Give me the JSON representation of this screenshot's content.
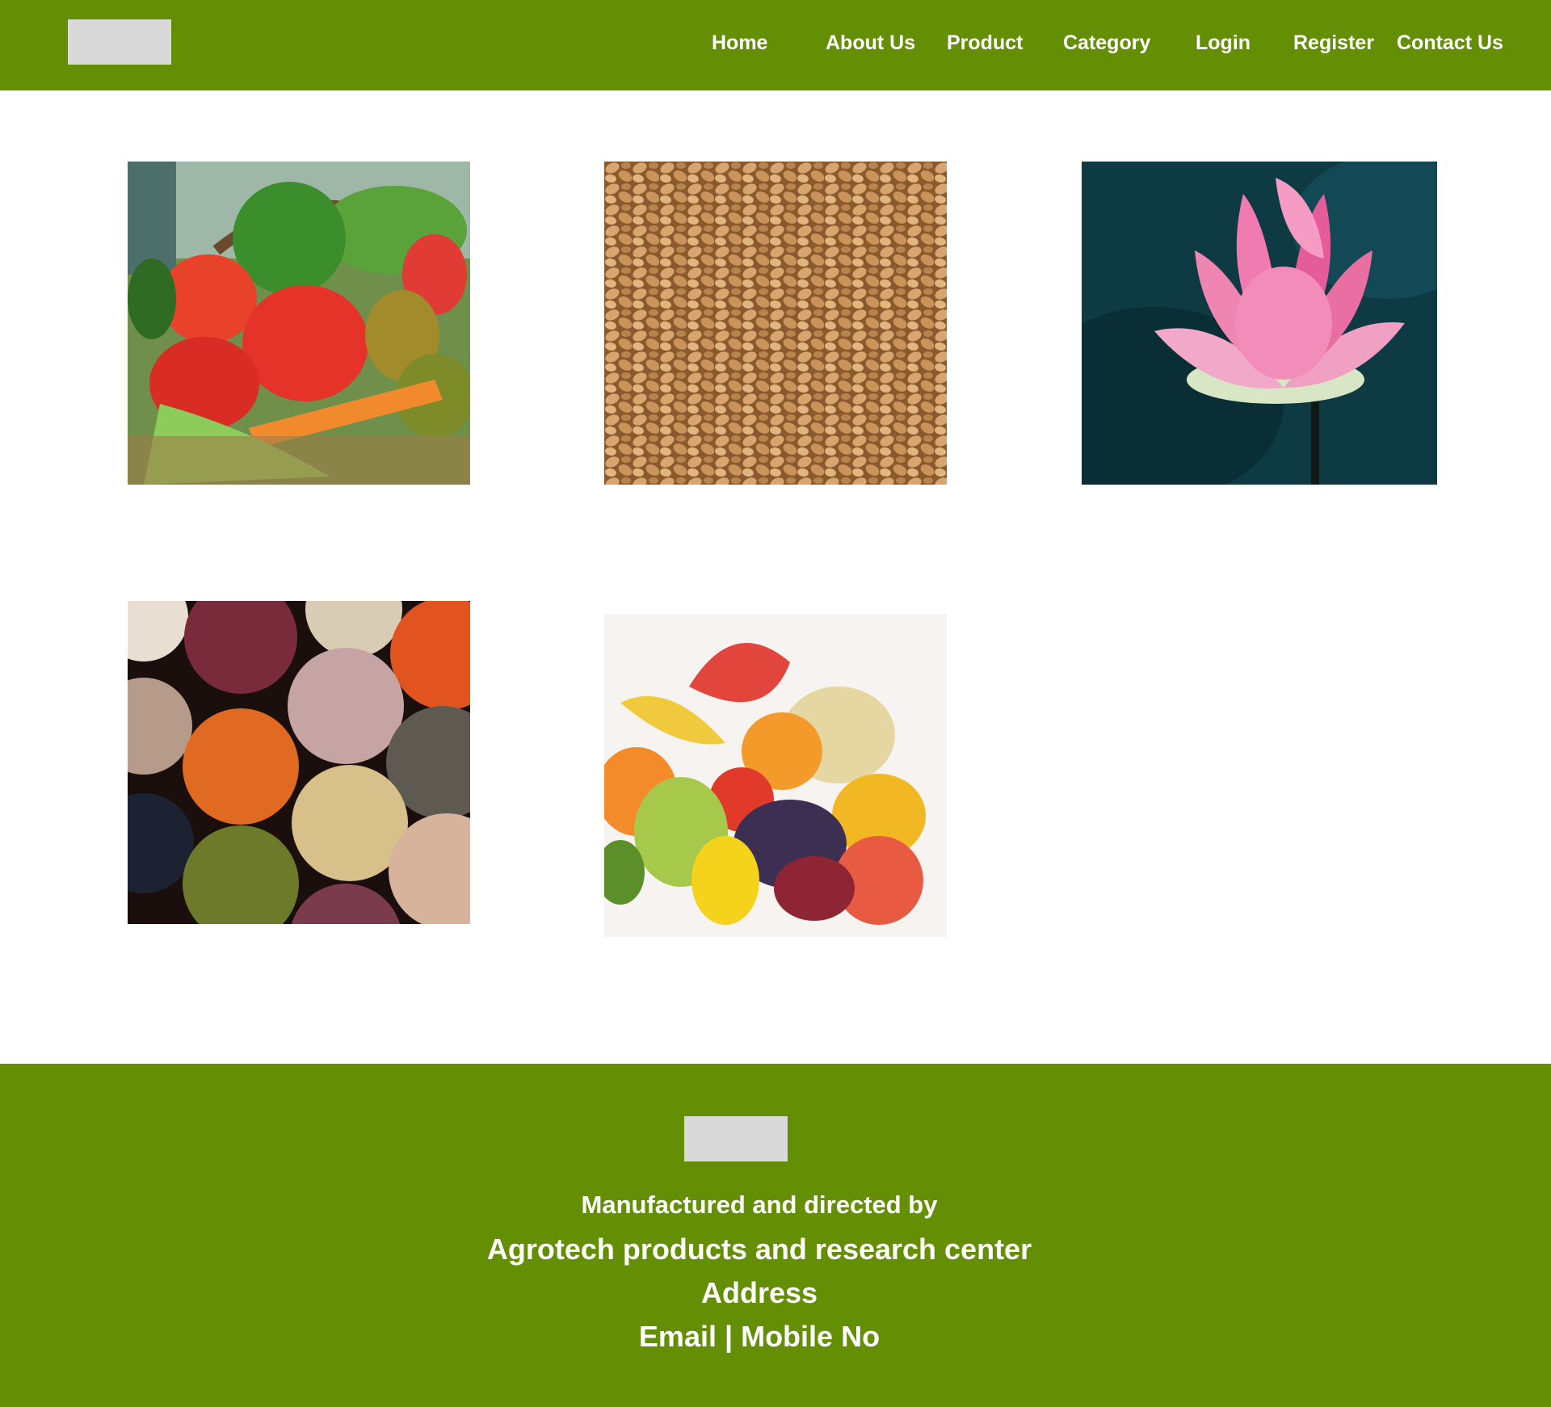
{
  "header": {
    "logo": "logo-placeholder",
    "nav": {
      "home": "Home",
      "about": "About Us",
      "product": "Product",
      "category": "Category",
      "login": "Login",
      "register": "Register",
      "contact": "Contact Us"
    }
  },
  "gallery": {
    "items": [
      {
        "name": "vegetables",
        "image": "vegetable basket"
      },
      {
        "name": "grains",
        "image": "wheat grains"
      },
      {
        "name": "flowers",
        "image": "pink lotus flower"
      },
      {
        "name": "pulses",
        "image": "bowls of beans and lentils"
      },
      {
        "name": "fruits",
        "image": "assorted fruits"
      }
    ]
  },
  "footer": {
    "logo": "logo-placeholder",
    "manufactured": "Manufactured and directed by",
    "company": "Agrotech products and research center",
    "address": "Address",
    "email": "Email",
    "separator": "|",
    "mobile": "Mobile No"
  },
  "colors": {
    "brand_green": "#648e04",
    "placeholder_gray": "#d9d9d9",
    "text": "#ffffff"
  }
}
